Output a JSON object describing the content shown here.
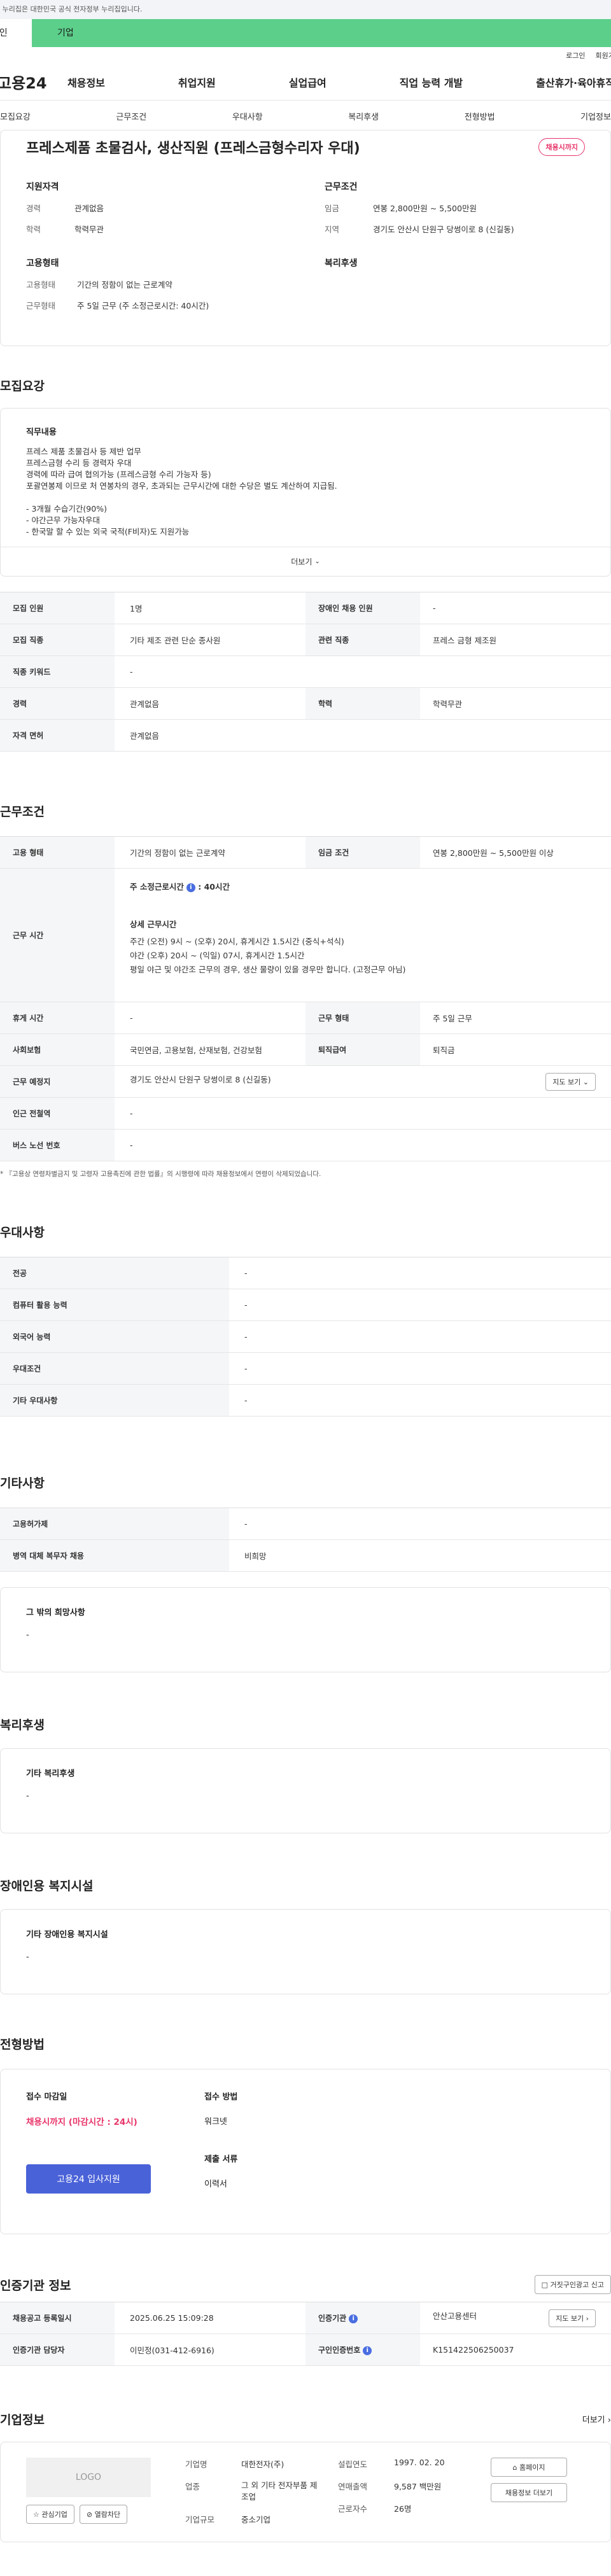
{
  "banner": "이 누리집은 대한민국 공식 전자정부 누리집입니다.",
  "type_tabs": {
    "personal": "개인",
    "business": "기업"
  },
  "util": {
    "login": "로그인",
    "signup": "회원가입"
  },
  "logo": "고용24",
  "gnb": [
    "채용정보",
    "취업지원",
    "실업급여",
    "직업 능력 개발",
    "출산휴가·육아휴직"
  ],
  "subnav": [
    "모집요강",
    "근무조건",
    "우대사항",
    "복리후생",
    "전형방법",
    "기업정보"
  ],
  "summary": {
    "title": "프레스제품 초물검사, 생산직원 (프레스금형수리자 우대)",
    "badge": "채용시까지",
    "qual_title": "지원자격",
    "career_label": "경력",
    "career": "관계없음",
    "edu_label": "학력",
    "edu": "학력무관",
    "cond_title": "근무조건",
    "wage_label": "임금",
    "wage": "연봉 2,800만원 ~ 5,500만원",
    "area_label": "지역",
    "area": "경기도 안산시 단원구 당썽이로 8 (신길동)",
    "emp_title": "고용형태",
    "emp_type_label": "고용형태",
    "emp_type": "기간의 정함이 없는 근로계약",
    "work_type_label": "근무형태",
    "work_type": "주 5일 근무 (주 소정근로시간: 40시간)",
    "welfare_title": "복리후생"
  },
  "recruit": {
    "section": "모집요강",
    "duty_title": "직무내용",
    "duty_lines": [
      "프레스 제품  초물검사 등 제반 업무",
      "프레스금형 수리 등 경력자 우대",
      "경력에 따라 급여 협의가능 (프레스금형 수리 가능자 등)",
      "포괄연봉제 이므로 처 연봉차의 경우, 초과되는 근무시간에 대한 수당은 별도 계산하여 지급됨.",
      "",
      "- 3개월 수습기간(90%)",
      "- 야간근무 가능자우대",
      "- 한국말 할 수 있는 외국 국적(F비자)도 지원가능"
    ],
    "more": "더보기",
    "rows": {
      "count_label": "모집 인원",
      "count": "1명",
      "disabled_label": "장애인 채용 인원",
      "disabled": "-",
      "job_label": "모집 직종",
      "job": "기타 제조 관련 단순 종사원",
      "related_label": "관련 직종",
      "related": "프레스 금형 제조원",
      "keyword_label": "직종 키워드",
      "keyword": "-",
      "career_label": "경력",
      "career": "관계없음",
      "edu_label": "학력",
      "edu": "학력무관",
      "license_label": "자격 면허",
      "license": "관계없음"
    }
  },
  "work": {
    "section": "근무조건",
    "emp_label": "고용 형태",
    "emp": "기간의 정함이 없는 근로계약",
    "wage_label": "임금 조건",
    "wage": "연봉 2,800만원 ~ 5,500만원 이상",
    "hours_label": "근무 시간",
    "hours_main": "주 소정근로시간",
    "hours_value": ": 40시간",
    "detail_title": "상세 근무시간",
    "detail_lines": [
      "주간 (오전) 9시  ~ (오후) 20시,    휴게시간 1.5시간 (중식+석식)",
      "야간 (오후) 20시 ~ (익일) 07시,    휴게시간 1.5시간",
      "평일 야근 및 야간조 근무의 경우, 생산 물량이 있을 경우만 합니다. (고정근무 아님)"
    ],
    "rest_label": "휴게 시간",
    "rest": "-",
    "wtype_label": "근무 형태",
    "wtype": "주 5일 근무",
    "insurance_label": "사회보험",
    "insurance": "국민연금, 고용보험, 산재보험, 건강보험",
    "retire_label": "퇴직급여",
    "retire": "퇴직금",
    "place_label": "근무 예정지",
    "place": "경기도 안산시 단원구 당썽이로 8 (신길동)",
    "map_btn": "지도 보기",
    "subway_label": "인근 전철역",
    "subway": "-",
    "bus_label": "버스 노선 번호",
    "bus": "-",
    "note": "『고용상 연령차별금지 및 고령자 고용촉진에 관한 법률』의 시행령에 따라 채용정보에서 연령이 삭제되었습니다."
  },
  "pref": {
    "section": "우대사항",
    "major_label": "전공",
    "major": "-",
    "pc_label": "컴퓨터 활용 능력",
    "pc": "-",
    "lang_label": "외국어 능력",
    "lang": "-",
    "cond_label": "우대조건",
    "cond": "-",
    "etc_label": "기타 우대사항",
    "etc": "-"
  },
  "other": {
    "section": "기타사항",
    "employ_label": "고용허가제",
    "employ": "-",
    "military_label": "병역 대체 복무자 채용",
    "military": "비희망",
    "wish_title": "그 밖의 희망사항",
    "wish": "-"
  },
  "welfare": {
    "section": "복리후생",
    "title": "기타 복리후생",
    "value": "-"
  },
  "disabled_fac": {
    "section": "장애인용 복지시설",
    "title": "기타 장애인용 복지시설",
    "value": "-"
  },
  "apply": {
    "section": "전형방법",
    "deadline_title": "접수 마감일",
    "deadline": "채용시까지 (마감시간 : 24시)",
    "button": "고용24 입사지원",
    "method_title": "접수 방법",
    "method": "워크넷",
    "docs_title": "제출 서류",
    "docs": "이력서"
  },
  "agency": {
    "section": "인증기관 정보",
    "report_btn": "거짓구인광고 신고",
    "reg_label": "채용공고 등록일시",
    "reg": "2025.06.25 15:09:28",
    "org_label": "인증기관",
    "org": "안산고용센터",
    "map_btn": "지도 보기",
    "manager_label": "인증기관 담당자",
    "manager": "이민정(031-412-6916)",
    "no_label": "구인인증번호",
    "no": "K151422506250037"
  },
  "company": {
    "section": "기업정보",
    "more": "더보기",
    "logo": "LOGO",
    "fav_btn": "관심기업",
    "block_btn": "열람차단",
    "name_label": "기업명",
    "name": "대한전자(주)",
    "industry_label": "업종",
    "industry": "그 외 기타 전자부품 제조업",
    "scale_label": "기업규모",
    "scale": "중소기업",
    "founded_label": "설립연도",
    "founded": "1997. 02. 20",
    "sales_label": "연매출액",
    "sales": "9,587 백만원",
    "staff_label": "근로자수",
    "staff": "26명",
    "home_btn": "홈페이지",
    "jobs_btn": "채용정보 더보기"
  }
}
